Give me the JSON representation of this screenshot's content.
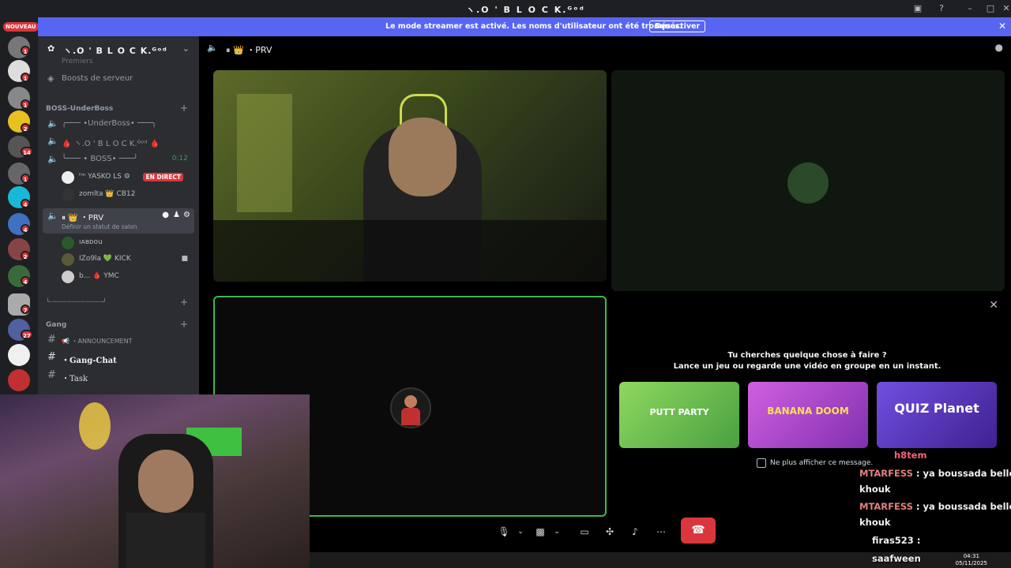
{
  "window": {
    "title": "ヽ.O ' B L O C K.ᴳᵒᵈ"
  },
  "banner": {
    "message": "Le mode streamer est activé. Les noms d'utilisateur ont été tronqués.",
    "button": "Désactiver"
  },
  "rail": {
    "new_label": "NOUVEAU",
    "badges": [
      "1",
      "1",
      "1",
      "2",
      "14",
      "1",
      "4",
      "4",
      "2",
      "4",
      "7",
      "27"
    ]
  },
  "sidebar": {
    "server_name": "ヽ.O ' B L O C K.ᴳᵒᵈ",
    "partial_top": "Premiers",
    "boosts": "Boosts de serveur",
    "category_boss": "BOSS-UnderBoss",
    "channels": [
      {
        "label": "╭─── •UnderBoss• ───╮"
      },
      {
        "label": "🩸 ヽ.O ' B L O C K.ᴳᵒᵈ 🩸"
      },
      {
        "label": "╰─── • BOSS• ───╯",
        "timer": "0:12"
      }
    ],
    "members_boss": [
      {
        "name": "ᶠᵐ YASKO LS ⚙",
        "badge": "EN DIRECT"
      },
      {
        "name": "zomlta 👑 CB12"
      }
    ],
    "prv_channel": "⏸ 👑 ・PRV",
    "prv_status": "Définir un statut de salon",
    "members_prv": [
      {
        "name": "ıᴀʙᴅou"
      },
      {
        "name": "IZo9la 💚 KICK"
      },
      {
        "name": "b... 🩸 YMC"
      }
    ],
    "decor_divider": "╰┈┈┈┈┈┈┈┈┈┈┈┈┈┈╯",
    "category_gang": "Gang",
    "gang_channels": [
      {
        "label": "📢 ・ANNOUNCEMENT"
      },
      {
        "label": "・Gang-Chat"
      },
      {
        "label": "・Task"
      }
    ]
  },
  "voice": {
    "channel_name": "⏸ 👑 ・PRV"
  },
  "activity": {
    "question": "Tu cherches quelque chose à faire ?",
    "subtitle": "Lance un jeu ou regarde une vidéo en groupe en un instant.",
    "games": [
      {
        "name": "PUTT PARTY",
        "color": "#7ec850"
      },
      {
        "name": "BANANA DOOM",
        "color": "#c050d0"
      },
      {
        "name": "QUIZ Planet",
        "color": "#6040d0"
      }
    ],
    "checkbox_label": "Ne plus afficher ce message."
  },
  "chat": [
    {
      "user": "h8tem",
      "text": ""
    },
    {
      "user": "MTARFESS",
      "text": "ya boussada bellehi"
    },
    {
      "user": "",
      "text": "khouk"
    },
    {
      "user": "MTARFESS",
      "text": "ya boussada bellehi"
    },
    {
      "user": "",
      "text": "khouk"
    },
    {
      "user": "firas523",
      "text": ""
    },
    {
      "user": "saafween",
      "text": ""
    }
  ],
  "taskbar": {
    "time": "04:31",
    "date": "05/11/2025"
  },
  "colors": {
    "accent": "#5865f2",
    "danger": "#da373c",
    "success": "#23a55a",
    "sidebar": "#2b2d31",
    "rail": "#1e1f22"
  }
}
